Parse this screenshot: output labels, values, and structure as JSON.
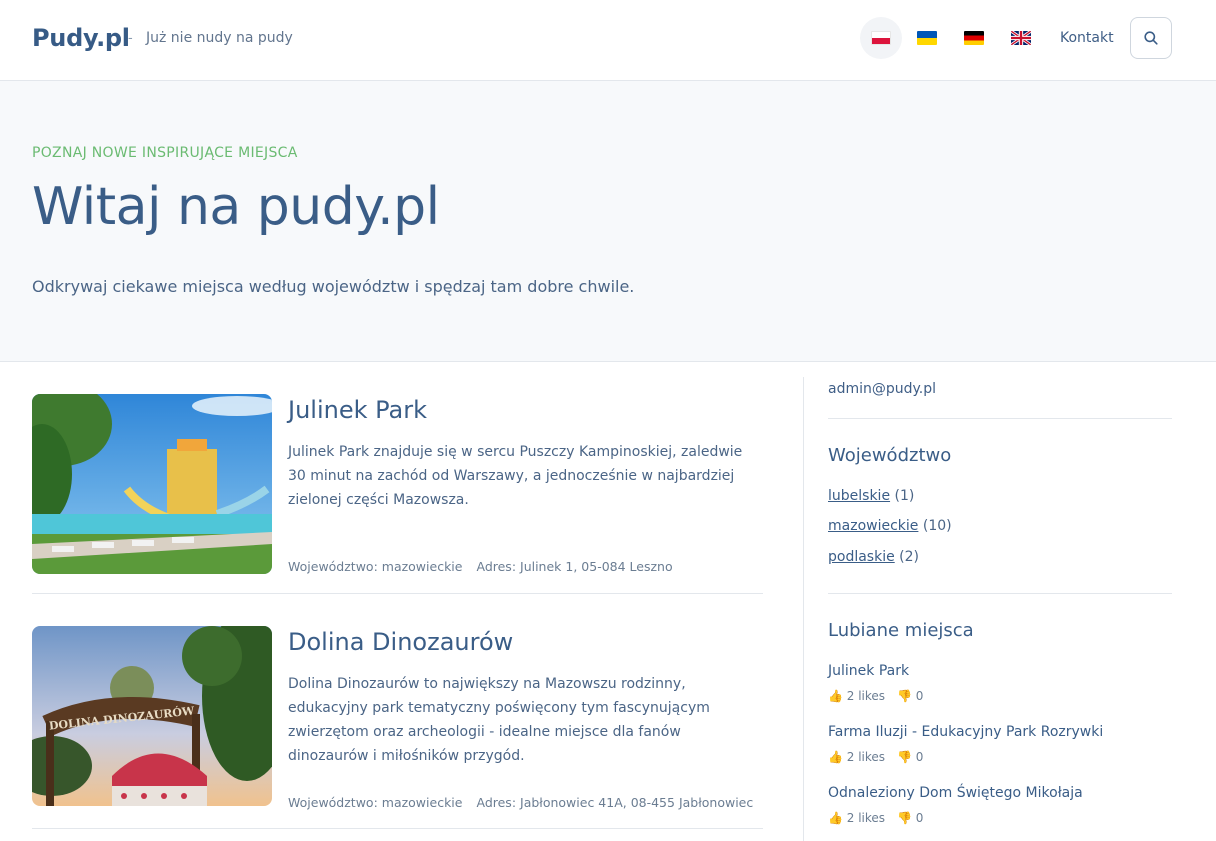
{
  "header": {
    "logo": "Pudy.pl",
    "separator": "-",
    "tagline": "Już nie nudy na pudy",
    "contact": "Kontakt"
  },
  "hero": {
    "eyebrow": "POZNAJ NOWE INSPIRUJĄCE MIEJSCA",
    "title": "Witaj na pudy.pl",
    "subtitle": "Odkrywaj ciekawe miejsca według województw i spędzaj tam dobre chwile."
  },
  "places": [
    {
      "title": "Julinek Park",
      "description": "Julinek Park znajduje się w sercu Puszczy Kampinoskiej, zaledwie 30 minut na zachód od Warszawy, a jednocześnie w najbardziej zielonej części Mazowsza.",
      "region": "Województwo: mazowieckie",
      "address": "Adres: Julinek 1, 05-084 Leszno"
    },
    {
      "title": "Dolina Dinozaurów",
      "description": "Dolina Dinozaurów to największy na Mazowszu rodzinny, edukacyjny park tematyczny poświęcony tym fascynującym zwierzętom oraz archeologii - idealne miejsce dla fanów dinozaurów i miłośników przygód.",
      "region": "Województwo: mazowieckie",
      "address": "Adres: Jabłonowiec 41A, 08-455 Jabłonowiec",
      "sign_text": "DOLINA DINOZAURÓW"
    }
  ],
  "sidebar": {
    "email": "admin@pudy.pl",
    "regions_heading": "Województwo",
    "regions": [
      {
        "name": "lubelskie",
        "count": "(1)"
      },
      {
        "name": "mazowieckie",
        "count": "(10)"
      },
      {
        "name": "podlaskie",
        "count": "(2)"
      }
    ],
    "favorites_heading": "Lubiane miejsca",
    "favorites": [
      {
        "name": "Julinek Park",
        "likes": "👍 2 likes",
        "dislikes": "👎 0"
      },
      {
        "name": "Farma Iluzji - Edukacyjny Park Rozrywki",
        "likes": "👍 2 likes",
        "dislikes": "👎 0"
      },
      {
        "name": "Odnaleziony Dom Świętego Mikołaja",
        "likes": "👍 2 likes",
        "dislikes": "👎 0"
      }
    ]
  },
  "colors": {
    "brand": "#375b86",
    "accent_green": "#6bbb72",
    "hero_bg": "#f7f9fb"
  },
  "icons": {
    "search": "search-icon",
    "flags": [
      "flag-pl-icon",
      "flag-ua-icon",
      "flag-de-icon",
      "flag-gb-icon"
    ]
  }
}
